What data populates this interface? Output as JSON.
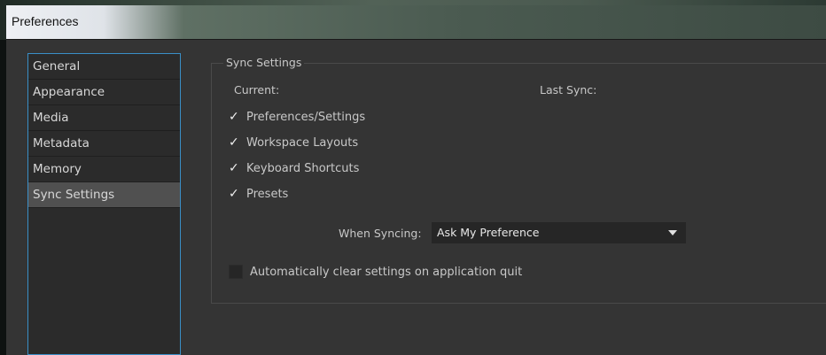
{
  "window": {
    "title": "Preferences"
  },
  "sidebar": {
    "items": [
      {
        "label": "General"
      },
      {
        "label": "Appearance"
      },
      {
        "label": "Media"
      },
      {
        "label": "Metadata"
      },
      {
        "label": "Memory"
      },
      {
        "label": "Sync Settings",
        "selected": true
      }
    ]
  },
  "sync": {
    "group_title": "Sync Settings",
    "current_label": "Current:",
    "last_sync_label": "Last Sync:",
    "options": [
      {
        "label": "Preferences/Settings",
        "checked": true
      },
      {
        "label": "Workspace Layouts",
        "checked": true
      },
      {
        "label": "Keyboard Shortcuts",
        "checked": true
      },
      {
        "label": "Presets",
        "checked": true
      }
    ],
    "check_glyph": "✓",
    "when_syncing_label": "When Syncing:",
    "when_syncing_value": "Ask My Preference",
    "auto_clear_label": "Automatically clear settings on application quit",
    "auto_clear_checked": false
  },
  "colors": {
    "accent": "#3a8fc7",
    "panel": "#343434",
    "selected": "#505050"
  }
}
